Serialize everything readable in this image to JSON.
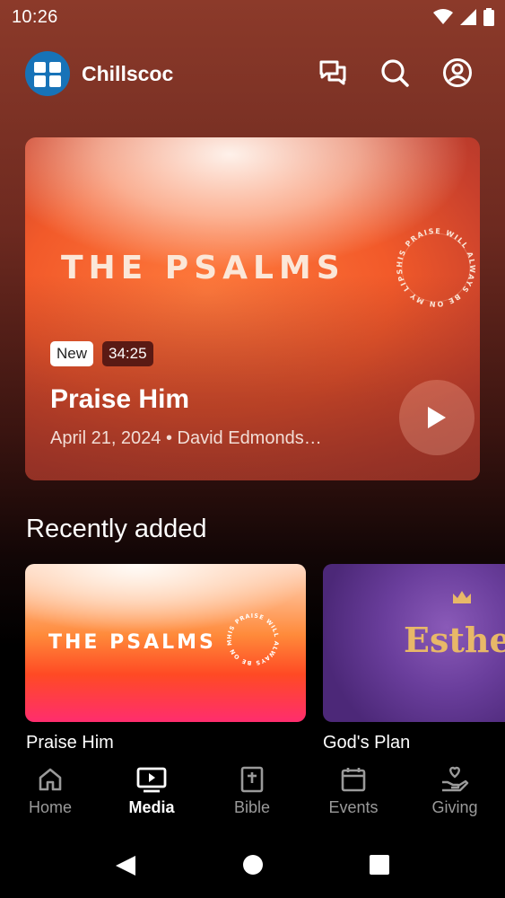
{
  "status_bar": {
    "time": "10:26"
  },
  "header": {
    "app_name": "Chillscoc"
  },
  "hero": {
    "artwork_title": "THE PSALMS",
    "artwork_ring_text": "HIS PRAISE WILL ALWAYS BE ON MY LIPS",
    "badge_new": "New",
    "badge_duration": "34:25",
    "title": "Praise Him",
    "meta": "April 21, 2024 • David Edmonds…"
  },
  "recently": {
    "section_title": "Recently added",
    "items": [
      {
        "artwork_title": "THE PSALMS",
        "label": "Praise Him"
      },
      {
        "artwork_title": "Esther",
        "label": "God's Plan"
      }
    ]
  },
  "nav": {
    "items": [
      {
        "label": "Home",
        "icon": "home-icon",
        "active": false
      },
      {
        "label": "Media",
        "icon": "media-icon",
        "active": true
      },
      {
        "label": "Bible",
        "icon": "bible-icon",
        "active": false
      },
      {
        "label": "Events",
        "icon": "calendar-icon",
        "active": false
      },
      {
        "label": "Giving",
        "icon": "giving-icon",
        "active": false
      }
    ]
  },
  "colors": {
    "accent": "#1773b8",
    "hero_orange": "#f25a2a",
    "esther_gold": "#e8b868"
  }
}
